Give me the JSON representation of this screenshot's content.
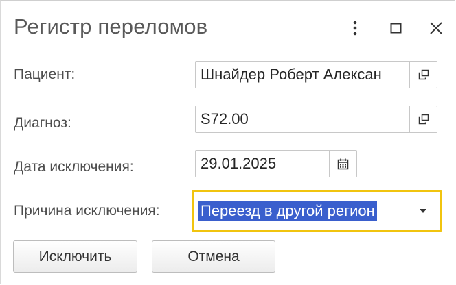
{
  "window": {
    "title": "Регистр переломов",
    "controls": [
      "more-icon",
      "maximize-icon",
      "close-icon"
    ]
  },
  "form": {
    "patient_label": "Пациент:",
    "patient_value": "Шнайдер Роберт Алексан",
    "diagnosis_label": "Диагноз:",
    "diagnosis_value": "S72.00",
    "date_label": "Дата исключения:",
    "date_value": "29.01.2025",
    "reason_label": "Причина исключения:",
    "reason_value": "Переезд в другой регион"
  },
  "buttons": {
    "exclude": "Исключить",
    "cancel": "Отмена"
  },
  "colors": {
    "focus_border": "#f1c40f",
    "selection": "#3a5fcd"
  }
}
